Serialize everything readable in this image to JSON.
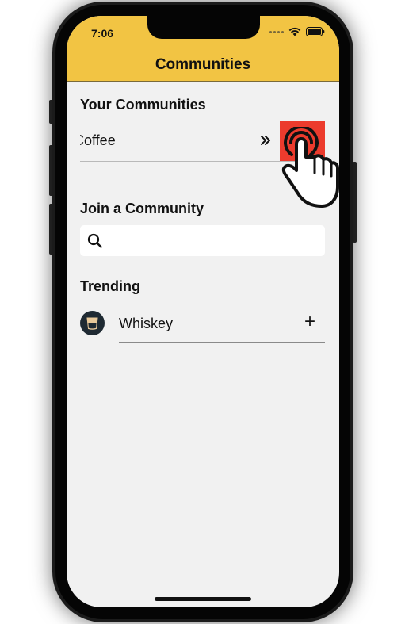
{
  "status_bar": {
    "time": "7:06"
  },
  "header": {
    "title": "Communities",
    "color": "#f2c443"
  },
  "your_communities": {
    "heading": "Your Communities",
    "items": [
      {
        "name": "Coffee",
        "action_color": "#ec3b2d"
      }
    ]
  },
  "join": {
    "heading": "Join a Community",
    "search_placeholder": "",
    "search_value": ""
  },
  "trending": {
    "heading": "Trending",
    "items": [
      {
        "name": "Whiskey",
        "icon": "glass-icon",
        "action": "+"
      }
    ]
  },
  "icons": {
    "search": "search-icon",
    "open": "chevrons-right-icon",
    "leave": "broadcast-icon",
    "gesture": "tap-hand-icon"
  }
}
